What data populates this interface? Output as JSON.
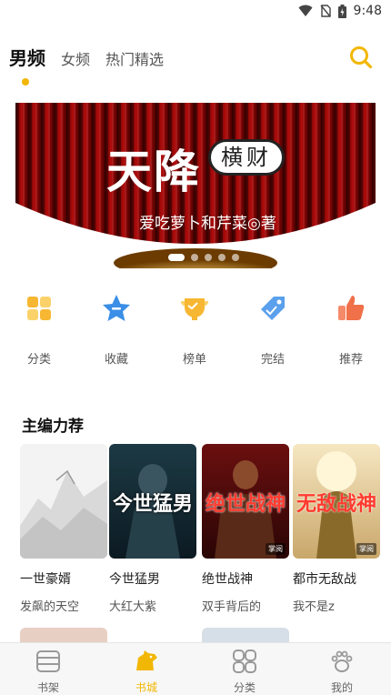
{
  "status_bar": {
    "time": "9:48"
  },
  "top_tabs": [
    {
      "label": "男频",
      "active": true
    },
    {
      "label": "女频",
      "active": false
    },
    {
      "label": "热门精选",
      "active": false
    }
  ],
  "banner": {
    "title": "天降",
    "seal": "横财",
    "author": "爱吃萝卜和芹菜◎著",
    "dot_count": 5,
    "active_dot": 0
  },
  "quick_entries": [
    {
      "label": "分类",
      "icon": "category-icon"
    },
    {
      "label": "收藏",
      "icon": "star-icon"
    },
    {
      "label": "榜单",
      "icon": "trophy-icon"
    },
    {
      "label": "完结",
      "icon": "tag-icon"
    },
    {
      "label": "推荐",
      "icon": "thumbs-up-icon"
    }
  ],
  "section": {
    "title": "主编力荐"
  },
  "books": [
    {
      "title": "一世豪婿",
      "author": "发飙的天空",
      "cover_text": "",
      "badge": ""
    },
    {
      "title": "今世猛男",
      "author": "大红大紫",
      "cover_text": "今世猛男",
      "badge": ""
    },
    {
      "title": "绝世战神",
      "author": "双手背后的",
      "cover_text": "绝世战神",
      "badge": "掌阅"
    },
    {
      "title": "都市无敌战",
      "author": "我不是z",
      "cover_text": "无敌战神",
      "badge": "掌阅"
    }
  ],
  "bottom_nav": [
    {
      "label": "书架",
      "icon": "bookshelf-icon",
      "active": false
    },
    {
      "label": "书城",
      "icon": "bookstore-icon",
      "active": true
    },
    {
      "label": "分类",
      "icon": "category-grid-icon",
      "active": false
    },
    {
      "label": "我的",
      "icon": "paw-icon",
      "active": false
    }
  ],
  "colors": {
    "accent": "#f2b705",
    "text": "#222222",
    "muted": "#555555"
  }
}
